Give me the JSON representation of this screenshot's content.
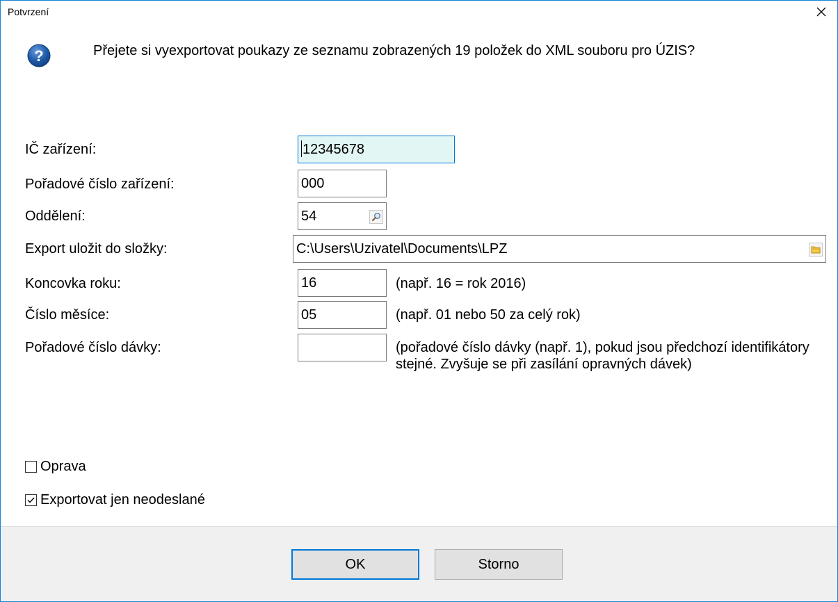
{
  "dialog": {
    "title": "Potvrzení",
    "message": "Přejete si vyexportovat poukazy ze seznamu zobrazených 19 položek do XML souboru pro ÚZIS?",
    "colors": {
      "accent": "#0078d7",
      "focused_field_bg": "#e2f6f3",
      "footer_bg": "#f0f0f0",
      "icon": "#1e5aa8"
    },
    "icons": {
      "close": "close-icon",
      "question": "question-icon",
      "search": "search-icon",
      "folder": "folder-icon"
    }
  },
  "form": {
    "ic_label": "IČ zařízení:",
    "ic_value": "12345678",
    "poradove_label": "Pořadové číslo zařízení:",
    "poradove_value": "000",
    "oddeleni_label": "Oddělení:",
    "oddeleni_value": "54",
    "export_label": "Export uložit do složky:",
    "export_value": "C:\\Users\\Uzivatel\\Documents\\LPZ",
    "rok_label": "Koncovka roku:",
    "rok_value": "16",
    "rok_hint": "(např. 16 = rok 2016)",
    "mesic_label": "Číslo měsíce:",
    "mesic_value": "05",
    "mesic_hint": "(např. 01 nebo 50 za celý rok)",
    "davka_label": "Pořadové číslo dávky:",
    "davka_value": "",
    "davka_hint": "(pořadové číslo dávky (např. 1), pokud jsou předchozí identifikátory stejné. Zvyšuje se při zasílání opravných dávek)"
  },
  "options": {
    "oprava_label": "Oprava",
    "oprava_checked": false,
    "neodeslane_label": "Exportovat jen neodeslané",
    "neodeslane_checked": true
  },
  "buttons": {
    "ok": "OK",
    "storno": "Storno"
  }
}
